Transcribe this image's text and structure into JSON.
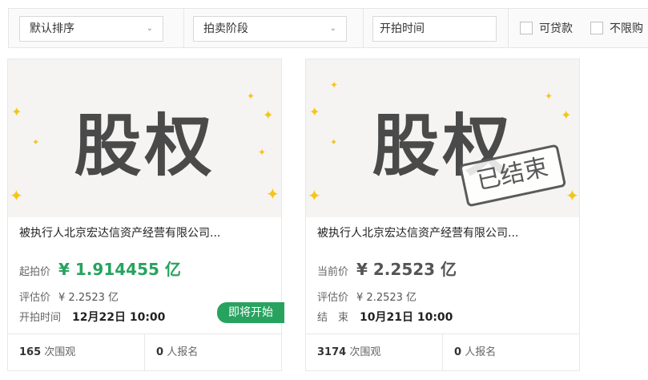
{
  "filters": {
    "sort": "默认排序",
    "stage": "拍卖阶段",
    "start_time_placeholder": "开拍时间",
    "loan_label": "可贷款",
    "no_limit_label": "不限购"
  },
  "cards": [
    {
      "image_text": "股权",
      "title": "被执行人北京宏达信资产经营有限公司...",
      "price_label": "起拍价",
      "price": "¥ 1.914455 亿",
      "appraisal_label": "评估价",
      "appraisal": "¥ 2.2523 亿",
      "time_label": "开拍时间",
      "time": "12月22日 10:00",
      "badge": "即将开始",
      "views_count": "165",
      "views_label": "次围观",
      "signup_count": "0",
      "signup_label": "人报名"
    },
    {
      "image_text": "股权",
      "stamp": "已结束",
      "title": "被执行人北京宏达信资产经营有限公司...",
      "price_label": "当前价",
      "price": "¥ 2.2523 亿",
      "appraisal_label": "评估价",
      "appraisal": "¥ 2.2523 亿",
      "time_label": "结　束",
      "time": "10月21日 10:00",
      "views_count": "3174",
      "views_label": "次围观",
      "signup_count": "0",
      "signup_label": "人报名"
    }
  ],
  "icons": {
    "chevron": "chevron-down-icon",
    "sparkle": "sparkle-icon"
  },
  "colors": {
    "accent_green": "#27a35f",
    "sparkle": "#f5c518"
  }
}
